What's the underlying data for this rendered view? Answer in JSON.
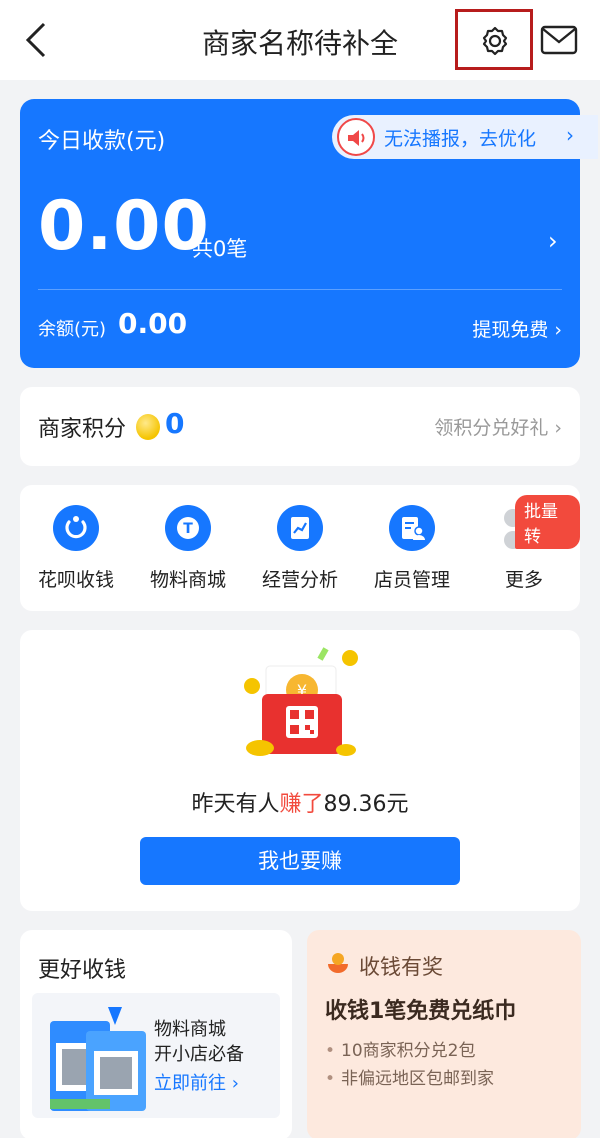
{
  "header": {
    "title": "商家名称待补全",
    "back_icon": "back-arrow-icon",
    "settings_icon": "gear-icon",
    "mail_icon": "mail-icon"
  },
  "balance_card": {
    "label": "今日收款(元)",
    "broadcast_text": "无法播报，去优化",
    "today_amount": "0.00",
    "count_text": "共0笔",
    "balance_label": "余额(元)",
    "balance_value": "0.00",
    "withdraw_text": "提现免费"
  },
  "points": {
    "label": "商家积分",
    "value": "0",
    "link_text": "领积分兑好礼"
  },
  "features": [
    {
      "label": "花呗收钱",
      "icon": "huabei-icon"
    },
    {
      "label": "物料商城",
      "icon": "store-icon"
    },
    {
      "label": "经营分析",
      "icon": "analytics-icon"
    },
    {
      "label": "店员管理",
      "icon": "staff-icon"
    },
    {
      "label": "更多",
      "icon": "more-icon"
    }
  ],
  "batch_badge": "批量转",
  "promo": {
    "text_before": "昨天有人",
    "text_highlight": "赚了",
    "text_after": "89.36元",
    "button": "我也要赚"
  },
  "collect_card": {
    "title": "更好收钱",
    "shop_title": "物料商城",
    "shop_sub": "开小店必备",
    "shop_link": "立即前往"
  },
  "reward_card": {
    "title": "收钱有奖",
    "headline": "收钱1笔免费兑纸巾",
    "bullets": [
      "10商家积分兑2包",
      "非偏远地区包邮到家"
    ]
  },
  "colors": {
    "primary": "#1677ff",
    "accent_red": "#f24a3d",
    "background": "#f2f3f5"
  }
}
